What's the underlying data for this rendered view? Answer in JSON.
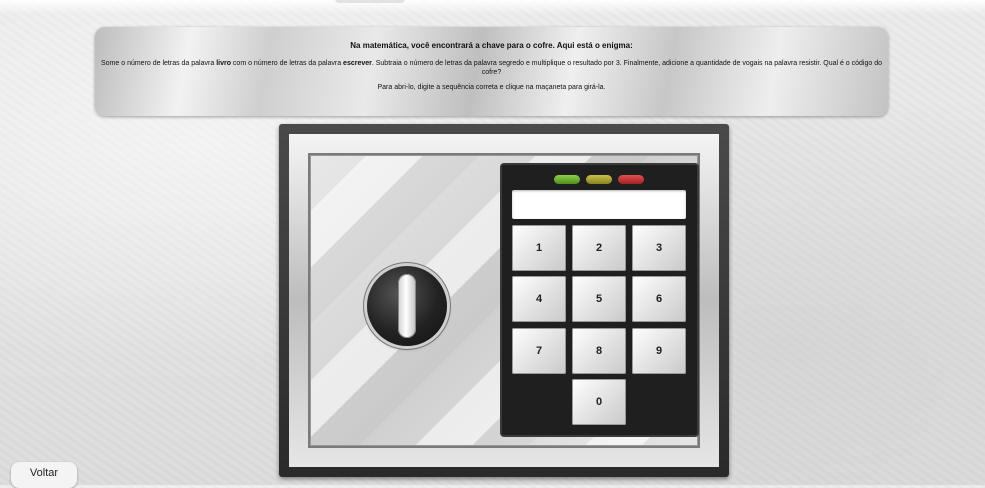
{
  "banner": {
    "title": "Na matemática, você encontrará a chave para o cofre. Aqui está o enigma:",
    "riddle_part1": "Some o número de letras da palavra ",
    "riddle_word1": "livro",
    "riddle_part2": " com o número de letras da palavra ",
    "riddle_word2": "escrever",
    "riddle_part3": ". Subtraia o número de letras da palavra segredo e multiplique o resultado por 3. Finalmente, adicione a quantidade de vogais na palavra resistir. Qual é o código do cofre?",
    "hint": "Para abri-lo, digite a sequência correta e clique na maçaneta para girá-la."
  },
  "keypad": {
    "display_value": "",
    "lights": [
      {
        "name": "green",
        "color": "#6fb034"
      },
      {
        "name": "yellow",
        "color": "#aaa236"
      },
      {
        "name": "red",
        "color": "#c83a3a"
      }
    ],
    "keys": [
      "1",
      "2",
      "3",
      "4",
      "5",
      "6",
      "7",
      "8",
      "9",
      "0"
    ]
  },
  "back_button": {
    "label": "Voltar"
  }
}
